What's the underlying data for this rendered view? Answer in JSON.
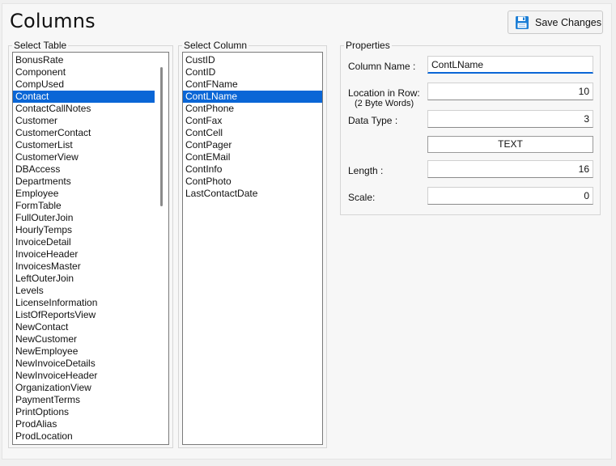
{
  "title": "Columns",
  "toolbar": {
    "save_label": "Save Changes",
    "save_icon": "floppy-disk-icon",
    "icon_color": "#1e7fd6"
  },
  "select_table": {
    "label": "Select Table",
    "selected_index": 3,
    "items": [
      "BonusRate",
      "Component",
      "CompUsed",
      "Contact",
      "ContactCallNotes",
      "Customer",
      "CustomerContact",
      "CustomerList",
      "CustomerView",
      "DBAccess",
      "Departments",
      "Employee",
      "FormTable",
      "FullOuterJoin",
      "HourlyTemps",
      "InvoiceDetail",
      "InvoiceHeader",
      "InvoicesMaster",
      "LeftOuterJoin",
      "Levels",
      "LicenseInformation",
      "ListOfReportsView",
      "NewContact",
      "NewCustomer",
      "NewEmployee",
      "NewInvoiceDetails",
      "NewInvoiceHeader",
      "OrganizationView",
      "PaymentTerms",
      "PrintOptions",
      "ProdAlias",
      "ProdLocation"
    ]
  },
  "select_column": {
    "label": "Select Column",
    "selected_index": 3,
    "items": [
      "CustID",
      "ContID",
      "ContFName",
      "ContLName",
      "ContPhone",
      "ContFax",
      "ContCell",
      "ContPager",
      "ContEMail",
      "ContInfo",
      "ContPhoto",
      "LastContactDate"
    ]
  },
  "properties": {
    "label": "Properties",
    "column_name_label": "Column Name :",
    "column_name_value": "ContLName",
    "location_label": "Location in Row:",
    "location_sub": "(2 Byte Words)",
    "location_value": "10",
    "data_type_label": "Data Type :",
    "data_type_value": "3",
    "type_button_label": "TEXT",
    "length_label": "Length :",
    "length_value": "16",
    "scale_label": "Scale:",
    "scale_value": "0"
  },
  "colors": {
    "selection": "#0a66d6"
  }
}
